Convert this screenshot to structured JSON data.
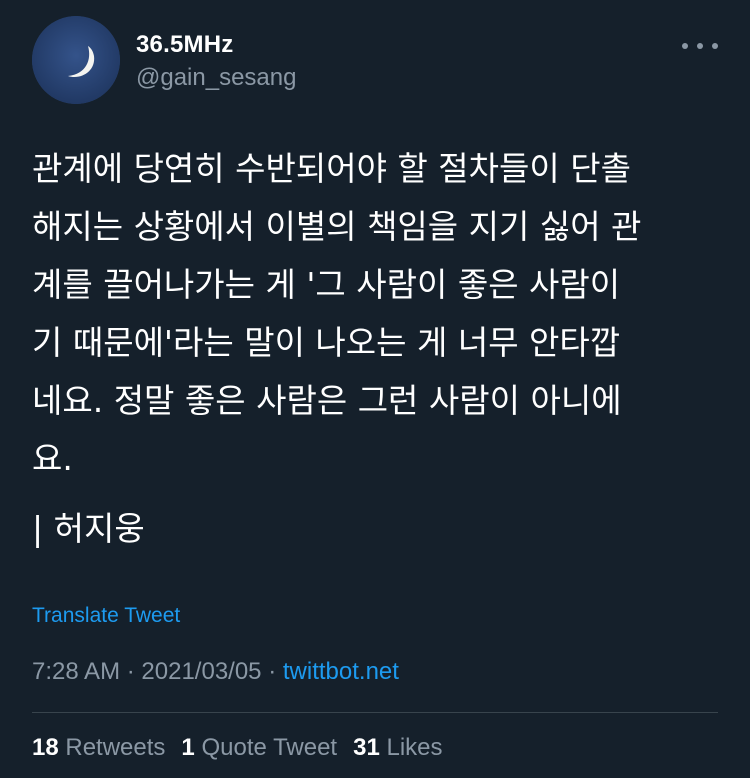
{
  "user": {
    "display_name": "36.5MHz",
    "handle": "@gain_sesang",
    "avatar_icon": "crescent-moon-icon"
  },
  "tweet": {
    "text": "관계에 당연히 수반되어야 할 절차들이 단촐\n해지는 상황에서 이별의 책임을 지기 싫어 관\n계를 끌어나가는 게 '그 사람이 좋은 사람이\n기 때문에'라는 말이 나오는 게 너무 안타깝\n네요. 정말 좋은 사람은 그런 사람이 아니에\n요.",
    "attribution": "| 허지웅",
    "translate_label": "Translate Tweet",
    "time": "7:28 AM",
    "date": "2021/03/05",
    "separator": "·",
    "source": "twittbot.net"
  },
  "stats": {
    "retweets_count": "18",
    "retweets_label": "Retweets",
    "quotes_count": "1",
    "quotes_label": "Quote Tweet",
    "likes_count": "31",
    "likes_label": "Likes"
  },
  "colors": {
    "background": "#15202b",
    "text_primary": "#ffffff",
    "text_secondary": "#8b98a5",
    "link": "#1d9bf0",
    "divider": "#38444d"
  }
}
